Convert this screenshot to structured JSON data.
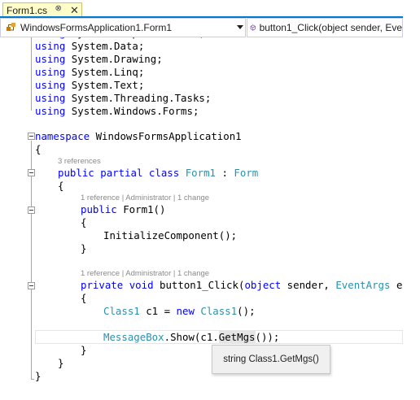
{
  "tab": {
    "title": "Form1.cs",
    "pin_glyph": "⊕",
    "close_glyph": "✕"
  },
  "navbar": {
    "class_dropdown": "WindowsFormsApplication1.Form1",
    "member_dropdown": "button1_Click(object sender, Eve"
  },
  "code": {
    "using_data": "System.Data;",
    "using_drawing": "System.Drawing;",
    "using_linq": "System.Linq;",
    "using_text": "System.Text;",
    "using_tasks": "System.Threading.Tasks;",
    "using_forms": "System.Windows.Forms;",
    "kw_using": "using",
    "kw_namespace": "namespace",
    "namespace_name": " WindowsFormsApplication1",
    "open_brace": "{",
    "close_brace": "}",
    "lens_class": "3 references",
    "kw_public": "public",
    "kw_partial": "partial",
    "kw_class": "class",
    "class_name": "Form1",
    "colon": " : ",
    "base_type": "Form",
    "lens_ctor": "1 reference | Administrator | 1 change",
    "ctor_sig": " Form1()",
    "ctor_body": "InitializeComponent();",
    "lens_method": "1 reference | Administrator | 1 change",
    "kw_private": "private",
    "kw_void": "void",
    "method_sig_a": " button1_Click(",
    "kw_object": "object",
    "method_sig_b": " sender, ",
    "event_args_type": "EventArgs",
    "method_sig_c": " e)",
    "class1_type": "Class1",
    "decl_mid": " c1 = ",
    "kw_new": "new",
    "ctor_call": "();",
    "msgbox_type": "MessageBox",
    "msgbox_a": ".Show(c1.",
    "msgbox_method": "GetMgs",
    "msgbox_b": "());"
  },
  "tooltip": {
    "text": "string Class1.GetMgs()"
  },
  "colors": {
    "keyword": "#0000ff",
    "type": "#2b91af",
    "tab_background": "#fefcc8",
    "accent": "#007acc"
  }
}
